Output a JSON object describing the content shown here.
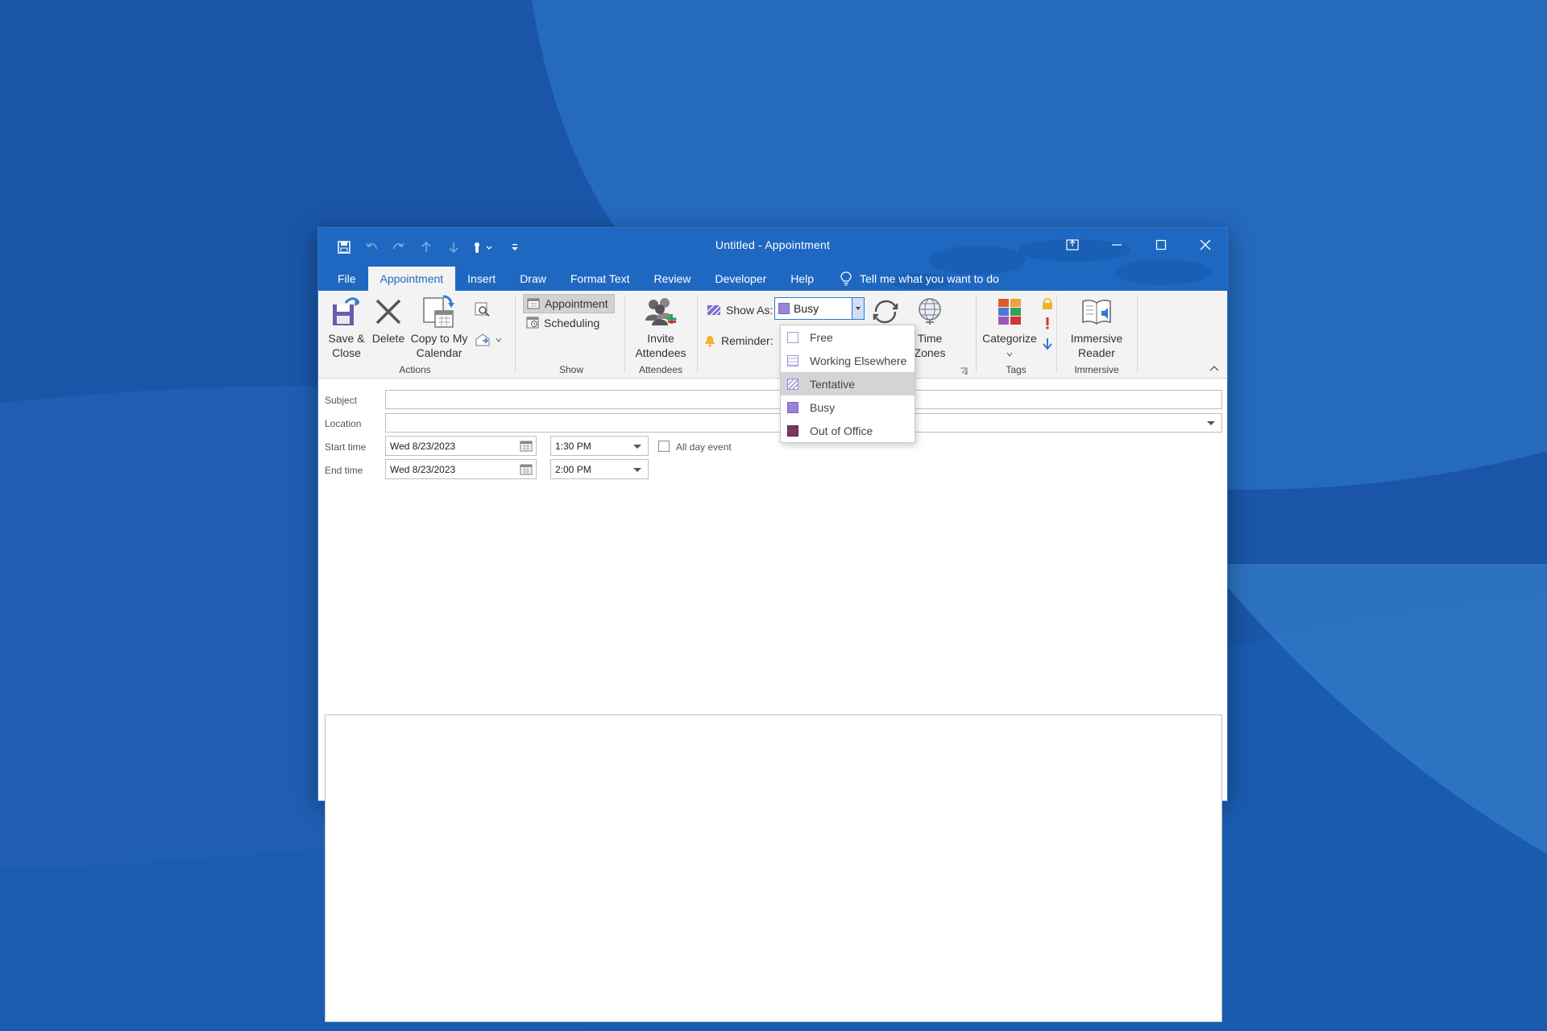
{
  "window": {
    "title": "Untitled  -  Appointment"
  },
  "tabs": [
    {
      "label": "File"
    },
    {
      "label": "Appointment"
    },
    {
      "label": "Insert"
    },
    {
      "label": "Draw"
    },
    {
      "label": "Format Text"
    },
    {
      "label": "Review"
    },
    {
      "label": "Developer"
    },
    {
      "label": "Help"
    }
  ],
  "tellme": {
    "label": "Tell me what you want to do"
  },
  "ribbon": {
    "actions": {
      "save_close": [
        "Save &",
        "Close"
      ],
      "delete": "Delete",
      "copy_calendar": [
        "Copy to My",
        "Calendar"
      ],
      "label": "Actions"
    },
    "show": {
      "appointment": "Appointment",
      "scheduling": "Scheduling",
      "label": "Show"
    },
    "attendees": {
      "invite": [
        "Invite",
        "Attendees"
      ],
      "label": "Attendees"
    },
    "options": {
      "show_as_label": "Show As:",
      "show_as_value": "Busy",
      "reminder_label": "Reminder:",
      "recurrence_partial": "ce",
      "time_zones": [
        "Time",
        "Zones"
      ]
    },
    "tags": {
      "categorize": "Categorize",
      "label": "Tags"
    },
    "immersive": {
      "reader": [
        "Immersive",
        "Reader"
      ],
      "label": "Immersive"
    }
  },
  "form": {
    "subject_label": "Subject",
    "location_label": "Location",
    "start_label": "Start time",
    "end_label": "End time",
    "start_date": "Wed 8/23/2023",
    "start_time": "1:30 PM",
    "end_date": "Wed 8/23/2023",
    "end_time": "2:00 PM",
    "all_day_label": "All day event"
  },
  "show_as_options": [
    {
      "label": "Free",
      "swatch": "free"
    },
    {
      "label": "Working Elsewhere",
      "swatch": "elsewhere"
    },
    {
      "label": "Tentative",
      "swatch": "tentative"
    },
    {
      "label": "Busy",
      "swatch": "busy"
    },
    {
      "label": "Out of Office",
      "swatch": "oof"
    }
  ],
  "colors": {
    "accent": "#1f68c2",
    "busy": "#9c82d8",
    "oof": "#7b3763",
    "desktop": "#1f5fb3"
  }
}
